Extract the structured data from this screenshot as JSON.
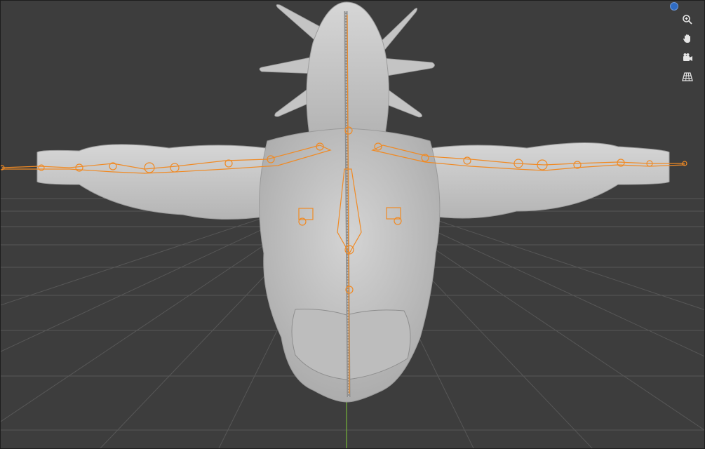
{
  "viewport": {
    "background": "#3d3d3d",
    "grid_color": "#555555",
    "axis_y_color": "#6a9c3a",
    "mesh_color": "#c9c9c9",
    "armature_color": "#f08a24"
  },
  "navigation_gizmo": {
    "axis_sphere_color": "#2f6cc4",
    "buttons": [
      {
        "name": "zoom",
        "icon": "zoom-icon"
      },
      {
        "name": "pan",
        "icon": "hand-icon"
      },
      {
        "name": "camera",
        "icon": "camera-icon"
      },
      {
        "name": "perspective",
        "icon": "grid-icon"
      }
    ]
  }
}
